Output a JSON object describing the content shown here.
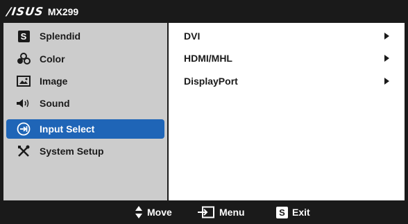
{
  "header": {
    "brand": "/ISUS",
    "model": "MX299"
  },
  "menu": {
    "items": [
      {
        "label": "Splendid",
        "icon": "splendid-s-icon"
      },
      {
        "label": "Color",
        "icon": "color-palette-icon"
      },
      {
        "label": "Image",
        "icon": "image-icon"
      },
      {
        "label": "Sound",
        "icon": "speaker-icon"
      },
      {
        "label": "Input Select",
        "icon": "input-select-icon",
        "selected": true
      },
      {
        "label": "System Setup",
        "icon": "tools-icon"
      }
    ]
  },
  "submenu": {
    "items": [
      {
        "label": "DVI"
      },
      {
        "label": "HDMI/MHL"
      },
      {
        "label": "DisplayPort"
      }
    ]
  },
  "footer": {
    "move_label": "Move",
    "menu_label": "Menu",
    "exit_label": "Exit",
    "exit_badge": "S"
  },
  "menu_badge_letter": "S",
  "colors": {
    "selected": "#1f65b7",
    "panel_gray": "#cccccc",
    "dark": "#1a1a1a"
  }
}
